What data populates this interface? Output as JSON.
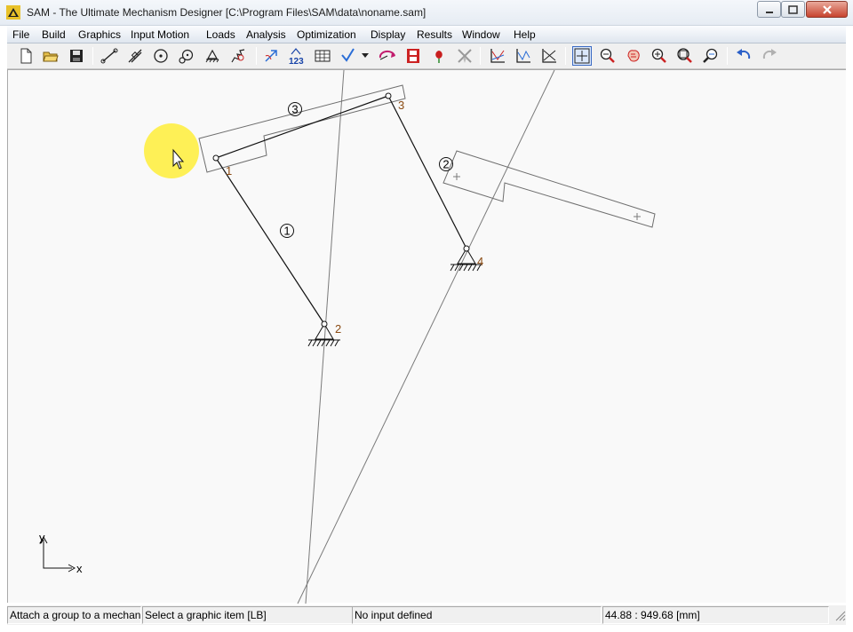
{
  "window": {
    "title": "SAM - The Ultimate Mechanism Designer [C:\\Program Files\\SAM\\data\\noname.sam]"
  },
  "menu": [
    "File",
    "Build",
    "Graphics",
    "Input Motion",
    "Loads",
    "Analysis",
    "Optimization",
    "Display",
    "Results",
    "Window",
    "Help"
  ],
  "toolbar": {
    "icons": [
      "new-file-icon",
      "open-folder-icon",
      "save-icon",
      "beam-element-icon",
      "slider-element-icon",
      "pulley-icon",
      "gear-icon",
      "fixed-support-icon",
      "spring-icon",
      "select-arrow-icon",
      "numbering-icon",
      "table-icon",
      "check-icon",
      "rotate-icon",
      "film-icon",
      "rose-icon",
      "windmill-icon",
      "graph-a-icon",
      "graph-b-icon",
      "graph-c-icon",
      "crosshair-icon",
      "zoom-out-icon",
      "pan-hand-icon",
      "zoom-in-icon",
      "zoom-window-icon",
      "zoom-fit-icon",
      "undo-icon",
      "redo-icon"
    ]
  },
  "mechanism": {
    "nodes": [
      {
        "id": "1",
        "label": "1"
      },
      {
        "id": "2",
        "label": "2"
      },
      {
        "id": "3",
        "label": "3"
      },
      {
        "id": "4",
        "label": "4"
      }
    ],
    "elements": [
      {
        "id": "1",
        "label": "1"
      },
      {
        "id": "2",
        "label": "2"
      },
      {
        "id": "3",
        "label": "3"
      }
    ],
    "axes": {
      "x": "x",
      "y": "y"
    }
  },
  "status": {
    "hint": "Attach a group to a mechan",
    "action": "Select a graphic item [LB]",
    "input": "No input defined",
    "coords": "44.88 : 949.68 [mm]"
  },
  "colors": {
    "node_label": "#8a4a12",
    "highlight": "#ffef3a",
    "canvas": "#f9f9f9"
  }
}
